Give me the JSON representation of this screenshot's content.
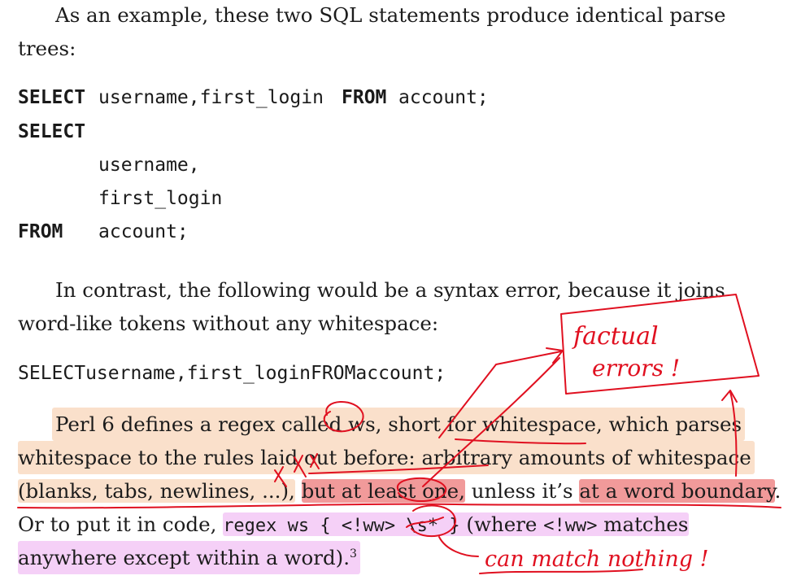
{
  "para1": {
    "line1": "As an example, these two SQL statements produce identical parse",
    "line2": "trees:"
  },
  "code1": {
    "kw_select": "SELECT",
    "line1_rest": "username,first_login",
    "kw_from": "FROM",
    "table": "account;",
    "kw_select2": "SELECT",
    "col1": "username,",
    "col2": "first_login",
    "kw_from2": "FROM",
    "table2": "account;"
  },
  "para2": {
    "line1": "In contrast, the following would be a syntax error, because it joins",
    "line2": "word-like tokens without any whitespace:"
  },
  "code2": "SELECTusername,first_loginFROMaccount;",
  "para3": {
    "line1": "Perl 6 defines a regex called ws, short for whitespace, which parses",
    "line2": "whitespace to the rules laid out before: arbitrary amounts of whitespace",
    "line3_a": "(blanks, tabs, newlines, ...),",
    "line3_b": "but at least one,",
    "line3_c": "unless it’s",
    "line3_d": "at a word boundary",
    "line3_e": ".",
    "line4_a": "Or to put it in code,",
    "line4_code": "regex ws { <!ww> \\s* }",
    "line4_b": "(where",
    "line4_code2": "<!ww>",
    "line4_c": "matches",
    "line5": "anywhere except within a word).",
    "footnote": "3"
  },
  "annotations": {
    "box_note_1": "factual",
    "box_note_2": "errors !",
    "bottom_note": "can match nothing !",
    "ink_color": "#e01020",
    "highlight_colors": [
      "#f6c6a0",
      "#ec7878",
      "#ecaaf0"
    ]
  }
}
